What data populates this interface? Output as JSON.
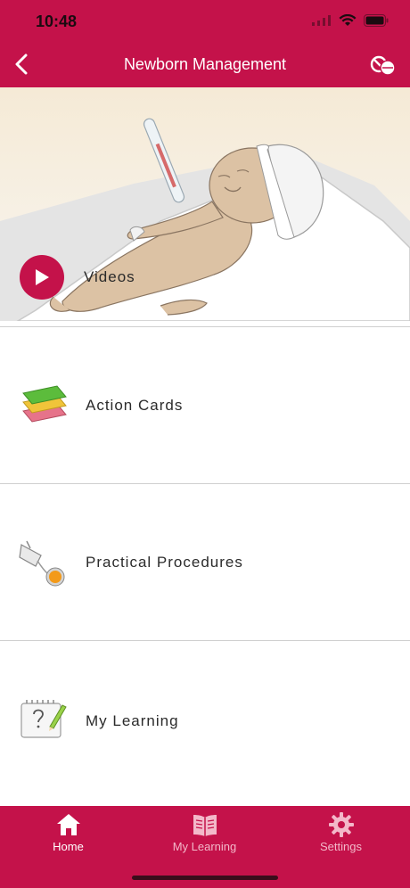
{
  "status_bar": {
    "time": "10:48"
  },
  "nav": {
    "title": "Newborn Management",
    "back_icon": "chevron-left-icon",
    "right_icon": "pills-icon"
  },
  "hero": {
    "label": "Videos",
    "icon": "play-icon"
  },
  "menu": {
    "items": [
      {
        "label": "Action Cards",
        "icon": "action-cards-icon"
      },
      {
        "label": "Practical Procedures",
        "icon": "procedure-device-icon"
      },
      {
        "label": "My Learning",
        "icon": "notepad-pencil-icon"
      }
    ]
  },
  "tabbar": {
    "items": [
      {
        "label": "Home",
        "icon": "home-icon",
        "active": true
      },
      {
        "label": "My Learning",
        "icon": "book-icon",
        "active": false
      },
      {
        "label": "Settings",
        "icon": "gear-icon",
        "active": false
      }
    ]
  },
  "colors": {
    "brand": "#c4124a",
    "tab_inactive": "#f3b8c9",
    "divider": "#cfcfcf"
  }
}
